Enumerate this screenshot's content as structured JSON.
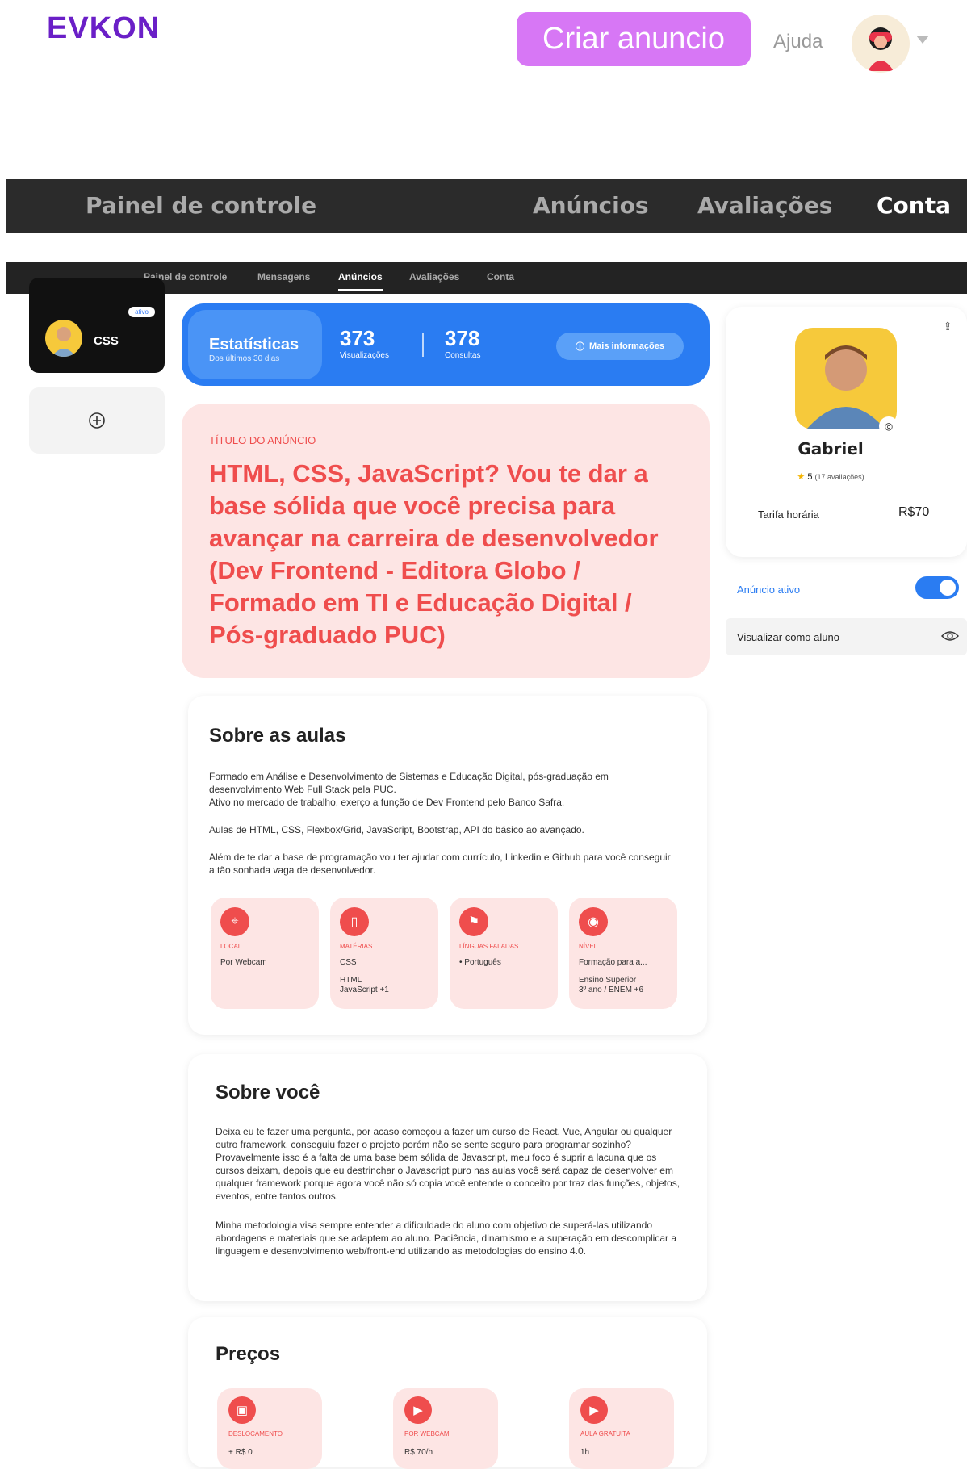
{
  "header": {
    "logo": "EVKON",
    "create_button": "Criar anuncio",
    "help": "Ajuda"
  },
  "big_nav": {
    "items": [
      "Painel de controle",
      "Anúncios",
      "Avaliações",
      "Conta"
    ]
  },
  "small_nav": {
    "items": [
      "Painel de controle",
      "Mensagens",
      "Anúncios",
      "Avaliações",
      "Conta"
    ]
  },
  "ad_card": {
    "label": "CSS",
    "badge": "ativo"
  },
  "stats": {
    "title": "Estatísticas",
    "subtitle": "Dos últimos 30 dias",
    "views": "373",
    "views_label": "Visualizações",
    "consults": "378",
    "consults_label": "Consultas",
    "more_button": "Mais informações"
  },
  "ad_title": {
    "eyebrow": "TÍTULO DO ANÚNCIO",
    "text": "HTML, CSS, JavaScript? Vou te dar a base sólida que você precisa para avançar na carreira de desenvolvedor (Dev Frontend - Editora Globo / Formado em TI e Educação Digital / Pós-graduado PUC)"
  },
  "about_classes": {
    "heading": "Sobre as aulas",
    "p1": "Formado em Análise e Desenvolvimento de Sistemas e Educação Digital, pós-graduação em desenvolvimento Web Full Stack pela PUC.",
    "p2": "Ativo no mercado de trabalho, exerço a função de Dev Frontend pelo Banco Safra.",
    "p3": "Aulas de HTML, CSS, Flexbox/Grid, JavaScript, Bootstrap, API do básico ao avançado.",
    "p4": "Além de te dar a base de programação vou ter ajudar com currículo, Linkedin e Github para você conseguir a tão sonhada vaga de desenvolvedor.",
    "tiles": [
      {
        "caption": "LOCAL",
        "lines": [
          "Por Webcam"
        ]
      },
      {
        "caption": "MATÉRIAS",
        "lines": [
          "CSS",
          "HTML",
          "JavaScript +1"
        ]
      },
      {
        "caption": "LÍNGUAS FALADAS",
        "lines": [
          "• Português"
        ]
      },
      {
        "caption": "NÍVEL",
        "lines": [
          "Formação para a...",
          "Ensino Superior",
          "3º ano / ENEM +6"
        ]
      }
    ]
  },
  "about_you": {
    "heading": "Sobre você",
    "p1": "Deixa eu te fazer uma pergunta, por acaso começou a fazer um curso de React, Vue, Angular ou qualquer outro framework, conseguiu fazer o projeto porém não se sente seguro para programar sozinho? Provavelmente isso é a falta de uma base bem sólida de Javascript, meu foco é suprir a lacuna que os cursos deixam, depois que eu destrinchar o Javascript puro nas aulas você será capaz de desenvolver em qualquer framework porque agora você não só copia você entende o conceito por traz das funções, objetos, eventos, entre tantos outros.",
    "p2": "Minha metodologia visa sempre entender a dificuldade do aluno com objetivo de superá-las utilizando abordagens e materiais que se adaptem ao aluno. Paciência, dinamismo e a superação em descomplicar a linguagem e desenvolvimento web/front-end utilizando as metodologias do ensino 4.0."
  },
  "prices": {
    "heading": "Preços",
    "tiles": [
      {
        "caption": "DESLOCAMENTO",
        "value": "+ R$ 0"
      },
      {
        "caption": "POR WEBCAM",
        "value": "R$ 70/h"
      },
      {
        "caption": "AULA GRATUITA",
        "value": "1h"
      }
    ]
  },
  "profile": {
    "name": "Gabriel",
    "rating": "5",
    "reviews": "(17 avaliações)",
    "rate_label": "Tarifa horária",
    "rate": "R$70"
  },
  "toggle": {
    "label": "Anúncio ativo",
    "on": true
  },
  "view_as_student": "Visualizar como aluno",
  "colors": {
    "accent_purple": "#6a1fc7",
    "button_pink": "#d777f5",
    "blue": "#2a7cf2",
    "coral": "#ef4d4d",
    "pink_bg": "#fde5e4"
  }
}
